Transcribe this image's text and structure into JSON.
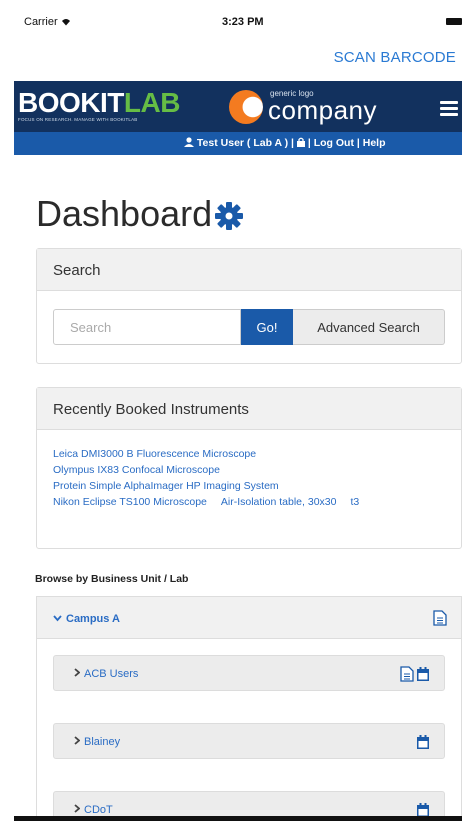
{
  "status_bar": {
    "carrier": "Carrier ",
    "time": "3:23 PM"
  },
  "header": {
    "scan_link": "SCAN BARCODE"
  },
  "brand": {
    "logo_part1": "BOOKIT",
    "logo_part2": "LAB",
    "tagline": "FOCUS ON RESEARCH. MANAGE WITH BOOKITLAB",
    "company_small": "generic logo",
    "company_big": "company"
  },
  "user_bar": {
    "user": "Test User ( Lab A )",
    "separator": " | ",
    "logout": "Log Out",
    "help": "Help"
  },
  "page": {
    "title": "Dashboard"
  },
  "search_panel": {
    "heading": "Search",
    "placeholder": "Search",
    "go_label": "Go!",
    "advanced_label": "Advanced Search"
  },
  "recent_panel": {
    "heading": "Recently Booked Instruments",
    "items": [
      "Leica DMI3000 B Fluorescence Microscope",
      "Olympus IX83 Confocal Microscope",
      "Protein Simple AlphaImager HP Imaging System",
      "Nikon Eclipse TS100 Microscope"
    ],
    "item4_extra": "Air-Isolation table, 30x30",
    "item4_extra2": "t3"
  },
  "browse": {
    "label": "Browse by Business Unit / Lab",
    "campus": "Campus A",
    "labs": [
      "ACB Users",
      "Blainey",
      "CDoT"
    ]
  },
  "colors": {
    "brand_navy": "#12315e",
    "brand_blue": "#1a5aa9",
    "link_blue": "#2a6cc4",
    "logo_green": "#66bd45",
    "logo_orange": "#f47b20"
  },
  "icons": [
    "wifi-icon",
    "battery-icon",
    "hamburger-menu-icon",
    "user-icon",
    "lock-icon",
    "gear-icon",
    "chevron-down-icon",
    "chevron-right-icon",
    "document-icon",
    "calendar-icon"
  ]
}
